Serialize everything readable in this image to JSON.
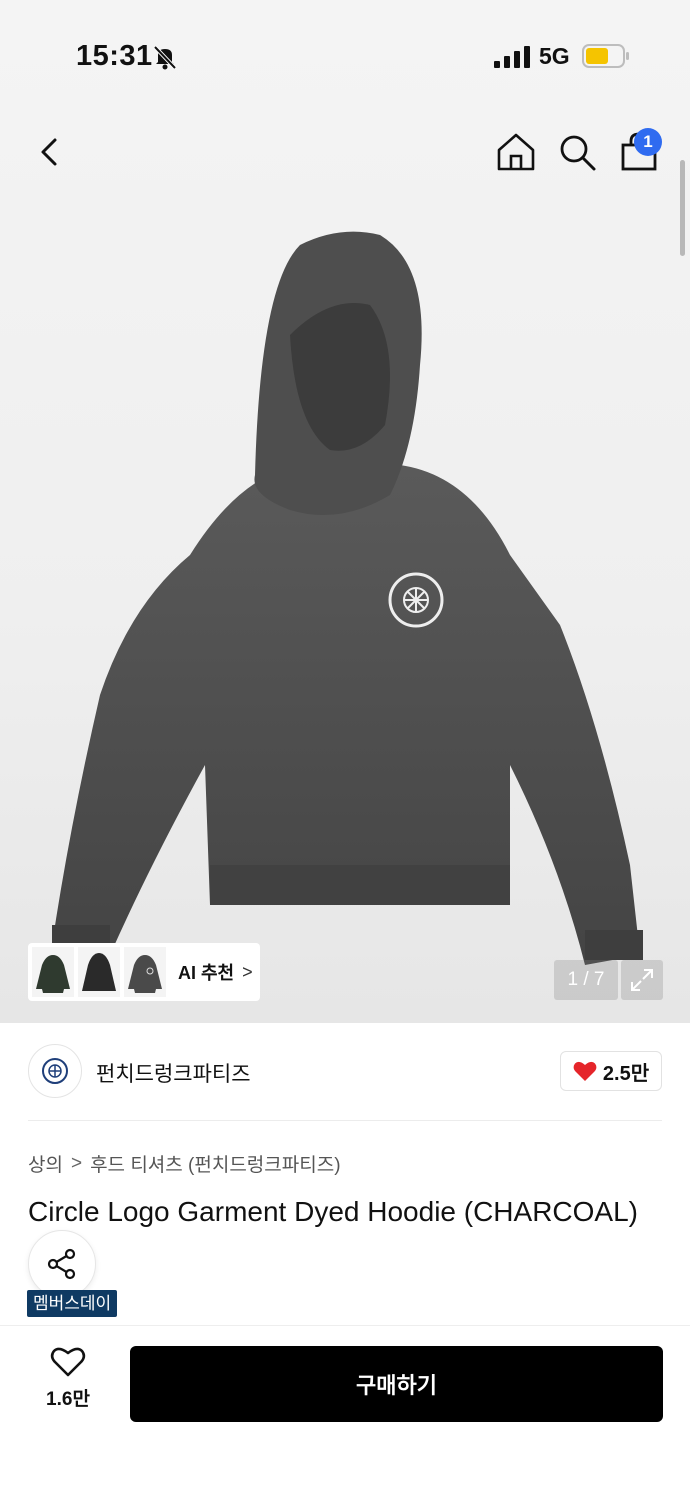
{
  "status_bar": {
    "time": "15:31",
    "network": "5G",
    "battery_color": "#f5c400"
  },
  "nav": {
    "cart_badge": "1",
    "badge_color": "#2f6bf0"
  },
  "gallery": {
    "ai_label": "AI 추천",
    "ai_chevron": ">",
    "pager": "1 / 7"
  },
  "brand": {
    "name": "펀치드렁크파티즈",
    "likes": "2.5만",
    "heart_color": "#e5252a"
  },
  "breadcrumb": {
    "items": [
      "상의",
      "후드 티셔츠 (펀치드렁크파티즈)"
    ],
    "separator": ">"
  },
  "product": {
    "title": "Circle Logo Garment Dyed Hoodie (CHARCOAL)",
    "tag": "멤버스데이",
    "tag_color": "#0f3a63"
  },
  "bottom_bar": {
    "wish_count": "1.6만",
    "buy_label": "구매하기"
  }
}
